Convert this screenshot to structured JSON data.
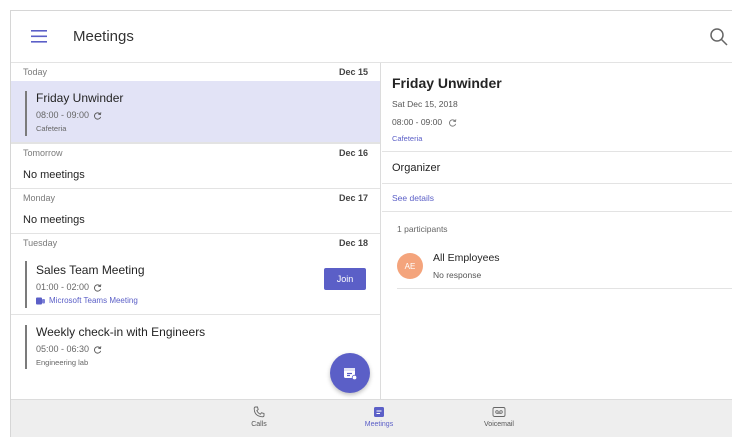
{
  "header": {
    "title": "Meetings"
  },
  "days": [
    {
      "label": "Today",
      "date": "Dec 15"
    },
    {
      "label": "Tomorrow",
      "date": "Dec 16",
      "empty_text": "No meetings"
    },
    {
      "label": "Monday",
      "date": "Dec 17",
      "empty_text": "No meetings"
    },
    {
      "label": "Tuesday",
      "date": "Dec 18"
    }
  ],
  "meetings": [
    {
      "title": "Friday Unwinder",
      "time": "08:00 - 09:00",
      "location": "Cafeteria"
    },
    {
      "title": "Sales Team Meeting",
      "time": "01:00 - 02:00",
      "link": "Microsoft Teams Meeting",
      "join_label": "Join"
    },
    {
      "title": "Weekly check-in with Engineers",
      "time": "05:00 - 06:30",
      "location": "Engineering lab"
    }
  ],
  "details": {
    "title": "Friday Unwinder",
    "date": "Sat Dec 15, 2018",
    "time": "08:00 - 09:00",
    "location": "Cafeteria",
    "organizer_label": "Organizer",
    "see_details": "See details",
    "participants_count": "1 participants",
    "participant": {
      "initials": "AE",
      "name": "All Employees",
      "status": "No response"
    }
  },
  "nav": [
    {
      "label": "Calls"
    },
    {
      "label": "Meetings"
    },
    {
      "label": "Voicemail"
    }
  ],
  "colors": {
    "accent": "#5b5fc7",
    "selected_bg": "#e2e3f6",
    "avatar": "#f4a47c",
    "nav_bg": "#eeeeee"
  }
}
